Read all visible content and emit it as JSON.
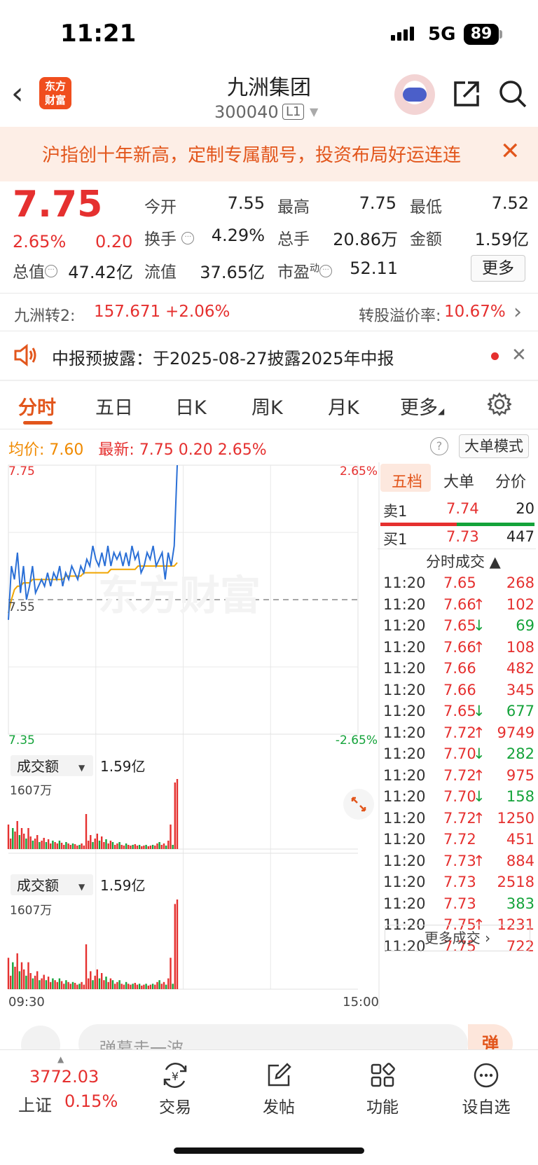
{
  "status_bar": {
    "time": "11:21",
    "network": "5G",
    "battery": "89"
  },
  "header": {
    "name": "九洲集团",
    "code": "300040",
    "level": "L1"
  },
  "banner": {
    "text": "沪指创十年新高，定制专属靓号，投资布局好运连连"
  },
  "quote": {
    "price": "7.75",
    "change_pct": "2.65%",
    "change_val": "0.20",
    "open_label": "今开",
    "open": "7.55",
    "high_label": "最高",
    "high": "7.75",
    "low_label": "最低",
    "low": "7.52",
    "turnover_label": "换手",
    "turnover": "4.29%",
    "volume_label": "总手",
    "volume": "20.86万",
    "amount_label": "金额",
    "amount": "1.59亿",
    "mktcap_label": "总值",
    "mktcap": "47.42亿",
    "float_label": "流值",
    "float": "37.65亿",
    "pe_label": "市盈",
    "pe_sup": "动",
    "pe": "52.11",
    "more": "更多"
  },
  "convertible": {
    "label": "九洲转2:",
    "price": "157.671",
    "change": "+2.06%",
    "premium_label": "转股溢价率:",
    "premium": "10.67%"
  },
  "notice": {
    "text": "中报预披露：于2025-08-27披露2025年中报"
  },
  "tabs": [
    "分时",
    "五日",
    "日K",
    "周K",
    "月K",
    "更多"
  ],
  "legend": {
    "avg_label": "均价:",
    "avg": "7.60",
    "latest_label": "最新:",
    "latest": "7.75",
    "chg": "0.20",
    "pct": "2.65%",
    "mode": "大单模式"
  },
  "chart_data": {
    "type": "line",
    "title": "",
    "y_axis": {
      "top": "7.75",
      "mid": "7.55",
      "bottom": "7.35",
      "top_pct": "2.65%",
      "bottom_pct": "-2.65%"
    },
    "ylim": [
      7.35,
      7.75
    ],
    "x_labels": [
      "09:30",
      "15:00"
    ],
    "series": [
      {
        "name": "价格",
        "color": "#2a6fd6",
        "values": [
          7.52,
          7.6,
          7.58,
          7.62,
          7.56,
          7.6,
          7.55,
          7.57,
          7.6,
          7.56,
          7.57,
          7.58,
          7.57,
          7.59,
          7.57,
          7.59,
          7.58,
          7.6,
          7.57,
          7.59,
          7.58,
          7.6,
          7.59,
          7.58,
          7.6,
          7.59,
          7.61,
          7.6,
          7.63,
          7.61,
          7.6,
          7.62,
          7.6,
          7.63,
          7.6,
          7.62,
          7.61,
          7.62,
          7.6,
          7.62,
          7.6,
          7.63,
          7.61,
          7.62,
          7.59,
          7.6,
          7.62,
          7.61,
          7.63,
          7.6,
          7.61,
          7.62,
          7.58,
          7.62,
          7.6,
          7.63,
          7.75
        ]
      },
      {
        "name": "均价",
        "color": "#f0a500",
        "values": [
          7.53,
          7.55,
          7.565,
          7.57,
          7.57,
          7.575,
          7.575,
          7.575,
          7.58,
          7.58,
          7.58,
          7.58,
          7.58,
          7.58,
          7.58,
          7.58,
          7.58,
          7.58,
          7.58,
          7.585,
          7.585,
          7.585,
          7.585,
          7.585,
          7.585,
          7.59,
          7.59,
          7.59,
          7.59,
          7.59,
          7.59,
          7.59,
          7.59,
          7.59,
          7.595,
          7.595,
          7.595,
          7.595,
          7.595,
          7.595,
          7.595,
          7.595,
          7.595,
          7.6,
          7.6,
          7.6,
          7.6,
          7.6,
          7.6,
          7.6,
          7.6,
          7.6,
          7.6,
          7.6,
          7.6,
          7.6,
          7.605
        ]
      }
    ],
    "volume_panels": [
      {
        "label": "成交额",
        "total": "1.59亿",
        "max_label": "1607万"
      },
      {
        "label": "成交额",
        "total": "1.59亿",
        "max_label": "1607万"
      }
    ],
    "volume_values": [
      0.35,
      0.15,
      0.3,
      0.25,
      0.4,
      0.2,
      0.3,
      0.22,
      0.15,
      0.3,
      0.18,
      0.12,
      0.15,
      0.2,
      0.1,
      0.12,
      0.16,
      0.1,
      0.14,
      0.08,
      0.12,
      0.1,
      0.08,
      0.12,
      0.09,
      0.06,
      0.1,
      0.08,
      0.06,
      0.08,
      0.07,
      0.05,
      0.06,
      0.08,
      0.05,
      0.5,
      0.12,
      0.2,
      0.1,
      0.15,
      0.22,
      0.12,
      0.18,
      0.1,
      0.14,
      0.08,
      0.12,
      0.1,
      0.06,
      0.08,
      0.1,
      0.06,
      0.05,
      0.08,
      0.06,
      0.05,
      0.06,
      0.07,
      0.05,
      0.06,
      0.04,
      0.05,
      0.06,
      0.04,
      0.05,
      0.06,
      0.05,
      0.08,
      0.1,
      0.06,
      0.08,
      0.05,
      0.12,
      0.35,
      0.06,
      0.95,
      1.0
    ]
  },
  "order_book": {
    "tabs": [
      "五档",
      "大单",
      "分价"
    ],
    "sell1": {
      "label": "卖1",
      "price": "7.74",
      "vol": "20"
    },
    "buy1": {
      "label": "买1",
      "price": "7.73",
      "vol": "447"
    },
    "trades_header": "分时成交",
    "trades": [
      {
        "time": "11:20",
        "price": "7.65",
        "arrow": "",
        "vol": "268",
        "dir": "buy"
      },
      {
        "time": "11:20",
        "price": "7.66",
        "arrow": "↑",
        "vol": "102",
        "dir": "buy"
      },
      {
        "time": "11:20",
        "price": "7.65",
        "arrow": "↓",
        "vol": "69",
        "dir": "sell"
      },
      {
        "time": "11:20",
        "price": "7.66",
        "arrow": "↑",
        "vol": "108",
        "dir": "buy"
      },
      {
        "time": "11:20",
        "price": "7.66",
        "arrow": "",
        "vol": "482",
        "dir": "buy"
      },
      {
        "time": "11:20",
        "price": "7.66",
        "arrow": "",
        "vol": "345",
        "dir": "buy"
      },
      {
        "time": "11:20",
        "price": "7.65",
        "arrow": "↓",
        "vol": "677",
        "dir": "sell"
      },
      {
        "time": "11:20",
        "price": "7.72",
        "arrow": "↑",
        "vol": "9749",
        "dir": "buy"
      },
      {
        "time": "11:20",
        "price": "7.70",
        "arrow": "↓",
        "vol": "282",
        "dir": "sell"
      },
      {
        "time": "11:20",
        "price": "7.72",
        "arrow": "↑",
        "vol": "975",
        "dir": "buy"
      },
      {
        "time": "11:20",
        "price": "7.70",
        "arrow": "↓",
        "vol": "158",
        "dir": "sell"
      },
      {
        "time": "11:20",
        "price": "7.72",
        "arrow": "↑",
        "vol": "1250",
        "dir": "buy"
      },
      {
        "time": "11:20",
        "price": "7.72",
        "arrow": "",
        "vol": "451",
        "dir": "buy"
      },
      {
        "time": "11:20",
        "price": "7.73",
        "arrow": "↑",
        "vol": "884",
        "dir": "buy"
      },
      {
        "time": "11:20",
        "price": "7.73",
        "arrow": "",
        "vol": "2518",
        "dir": "buy"
      },
      {
        "time": "11:20",
        "price": "7.73",
        "arrow": "",
        "vol": "383",
        "dir": "sell"
      },
      {
        "time": "11:20",
        "price": "7.75",
        "arrow": "↑",
        "vol": "1231",
        "dir": "buy"
      },
      {
        "time": "11:20",
        "price": "7.75",
        "arrow": "",
        "vol": "722",
        "dir": "buy"
      }
    ],
    "more_trades": "更多成交"
  },
  "comment": {
    "placeholder": "弹幕走一波...",
    "button": "弹"
  },
  "bottom_nav": {
    "index_value": "3772.03",
    "index_name": "上证",
    "index_pct": "0.15%",
    "items": [
      "交易",
      "发帖",
      "功能",
      "设自选"
    ]
  },
  "watermark": "东方财富",
  "colors": {
    "up": "#e5302f",
    "down": "#14a33a",
    "accent": "#e2561c",
    "price_line": "#2a6fd6",
    "avg_line": "#f0a500"
  }
}
